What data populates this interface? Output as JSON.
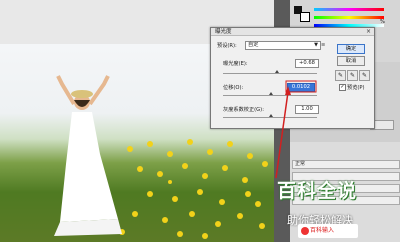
{
  "dialog": {
    "title": "曝光度",
    "close": "×",
    "preset_label": "预设(R):",
    "preset_value": "自定",
    "preset_arrow": "▼",
    "preset_options_glyph": "≡",
    "exposure_label": "曝光度(E):",
    "exposure_value": "+0.68",
    "offset_label": "位移(O):",
    "offset_value": "0.0102",
    "gamma_label": "灰度系数校正(G):",
    "gamma_value": "1.00",
    "ok_label": "确定",
    "cancel_label": "取消",
    "preview_label": "预览(P)",
    "preview_checked": "✓"
  },
  "right_panel": {
    "percent": "%",
    "rows": [
      "正常",
      "",
      "",
      ""
    ]
  },
  "watermark": {
    "line1": "百科全说",
    "line2": "助你轻松解决"
  },
  "logo": {
    "text": "百科输入"
  },
  "colors": {
    "accent": "#3875d7",
    "annotation": "#d22020",
    "watermark_green": "#2a7a2a"
  }
}
